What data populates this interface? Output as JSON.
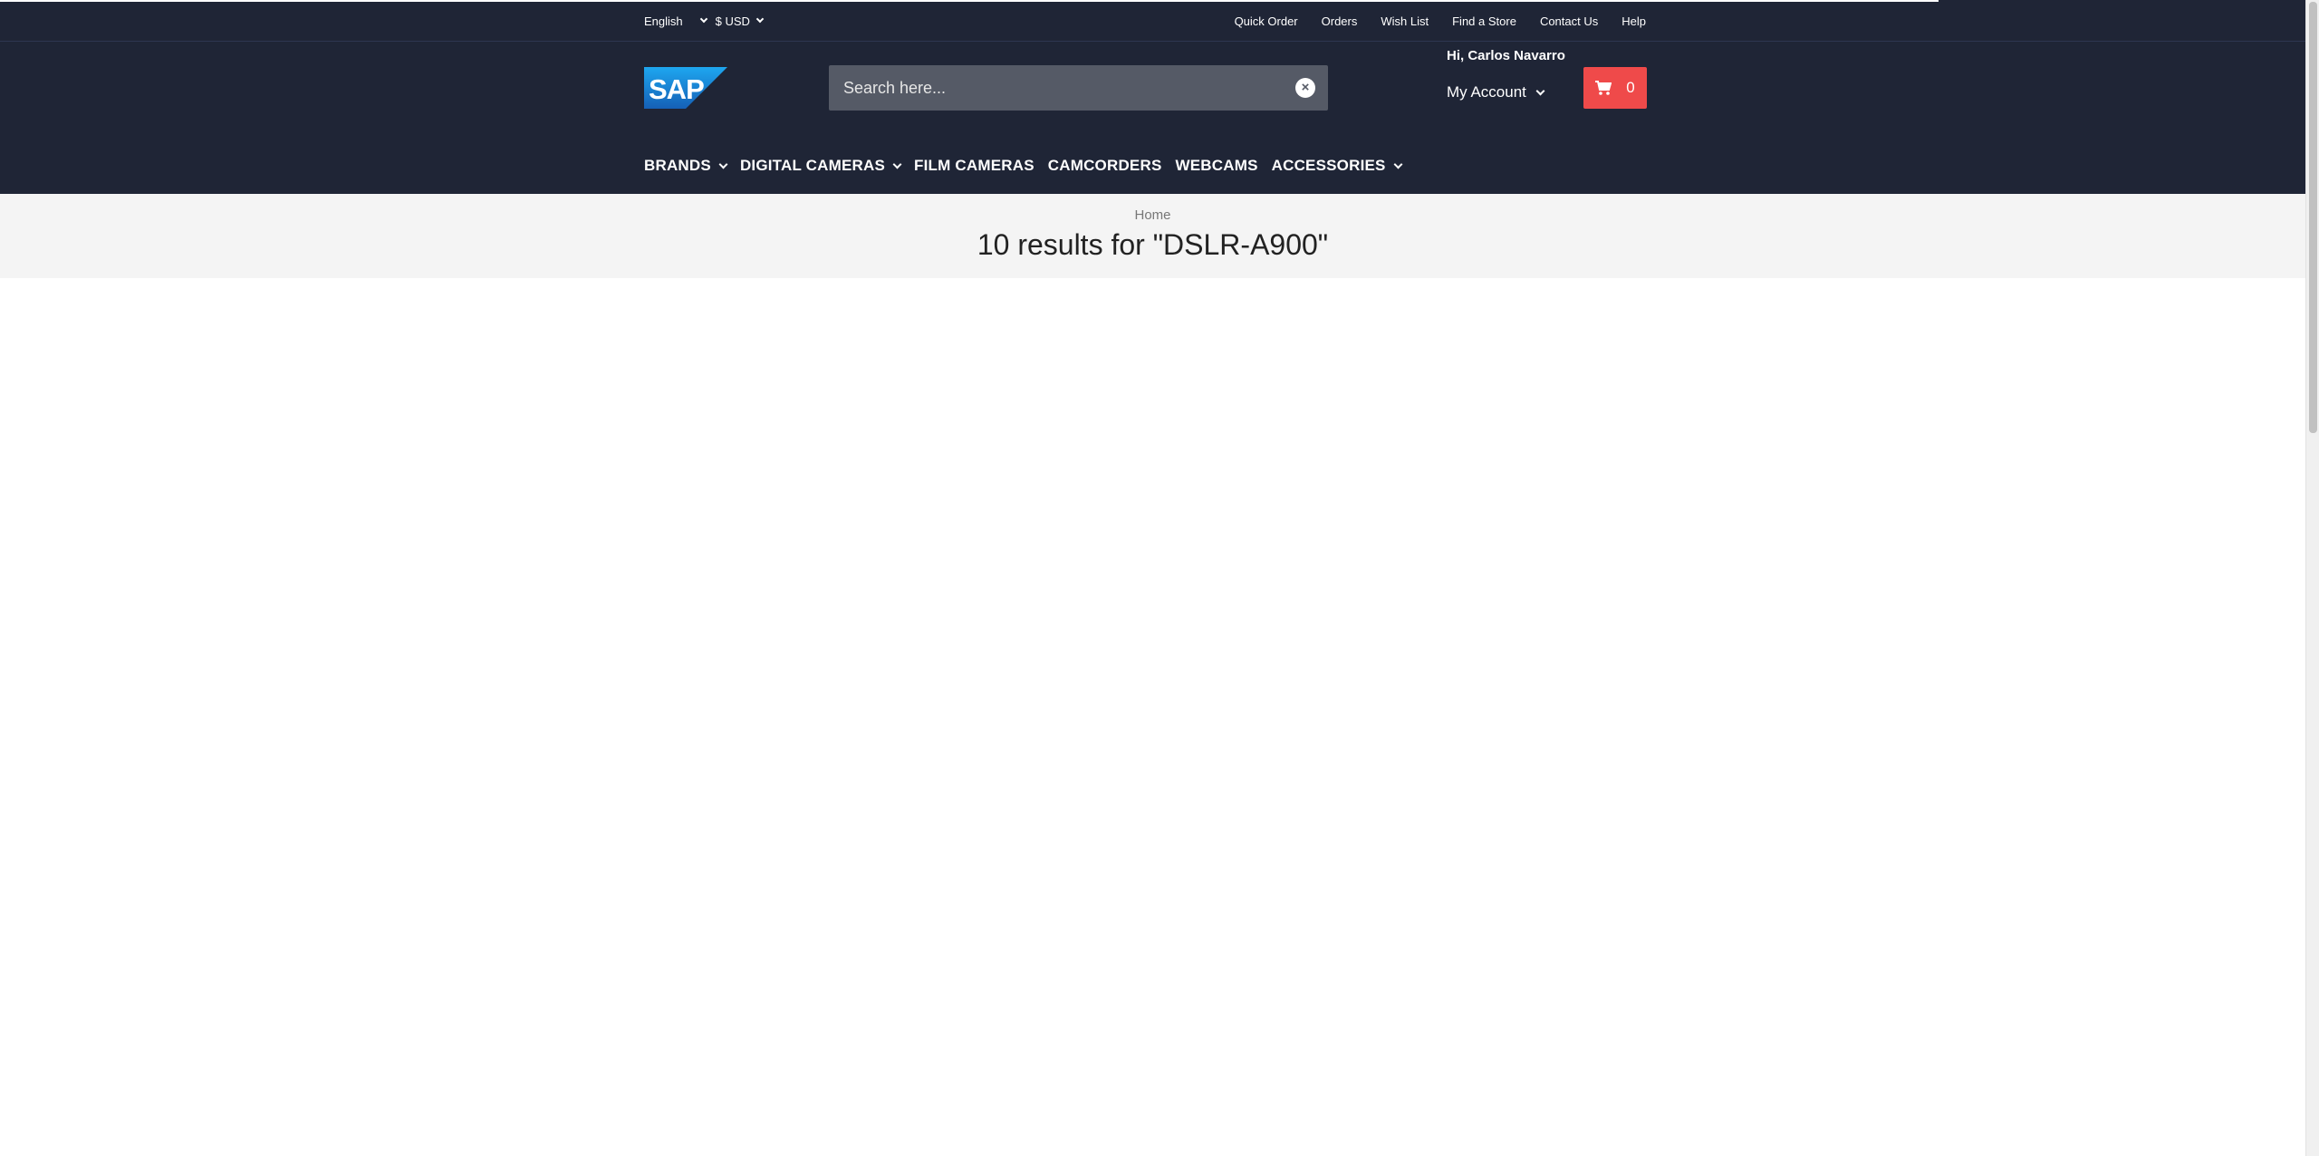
{
  "utility": {
    "language": "English",
    "currency": "$ USD",
    "links": [
      "Quick Order",
      "Orders",
      "Wish List",
      "Find a Store",
      "Contact Us",
      "Help"
    ]
  },
  "header": {
    "logo_text": "SAP",
    "search": {
      "placeholder": "Search here...",
      "value": ""
    },
    "greeting": "Hi, Carlos Navarro",
    "my_account": "My Account",
    "cart_count": "0"
  },
  "nav": [
    {
      "label": "BRANDS",
      "dropdown": true
    },
    {
      "label": "DIGITAL CAMERAS",
      "dropdown": true
    },
    {
      "label": "FILM CAMERAS",
      "dropdown": false
    },
    {
      "label": "CAMCORDERS",
      "dropdown": false
    },
    {
      "label": "WEBCAMS",
      "dropdown": false
    },
    {
      "label": "ACCESSORIES",
      "dropdown": true
    }
  ],
  "page": {
    "breadcrumb": "Home",
    "title": "10 results for \"DSLR-A900\""
  },
  "colors": {
    "header_bg": "#1f2536",
    "cart_accent": "#ef4a4a",
    "logo_blue": "#1a73c9"
  }
}
